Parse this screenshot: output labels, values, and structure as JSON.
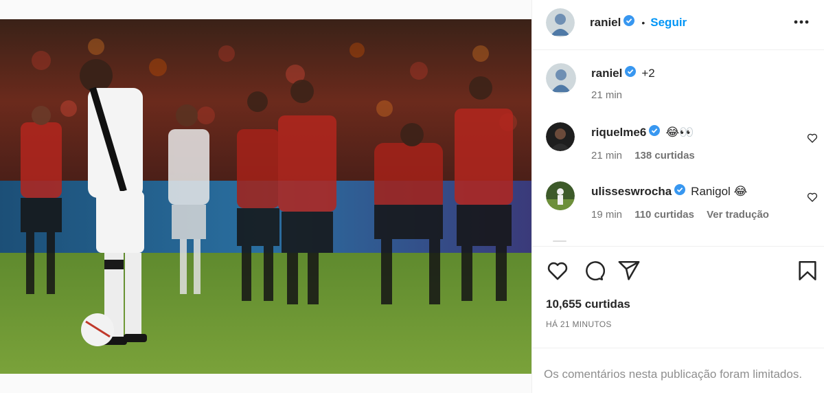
{
  "header": {
    "username": "raniel",
    "separator": "•",
    "follow_label": "Seguir",
    "avatar_icon": "profile-avatar",
    "verified_icon": "verified-badge-icon",
    "more_icon": "more-options-icon"
  },
  "caption": {
    "username": "raniel",
    "text": "+2",
    "time": "21 min"
  },
  "comments": [
    {
      "username": "riquelme6",
      "text": "😂👀",
      "time": "21 min",
      "likes": "138 curtidas"
    },
    {
      "username": "ulisseswrocha",
      "text": "Ranigol 😂",
      "time": "19 min",
      "likes": "110 curtidas",
      "translate": "Ver tradução"
    }
  ],
  "actions": {
    "like_icon": "heart-icon",
    "comment_icon": "comment-icon",
    "share_icon": "share-icon",
    "save_icon": "bookmark-icon"
  },
  "likes_count": "10,655 curtidas",
  "time_ago": "HÁ 21 MINUTOS",
  "comments_limited": "Os comentários nesta publicação foram limitados.",
  "colors": {
    "accent": "#0095f6",
    "verified": "#3897f0",
    "text": "#262626",
    "muted": "#737373",
    "border": "#efefef"
  }
}
